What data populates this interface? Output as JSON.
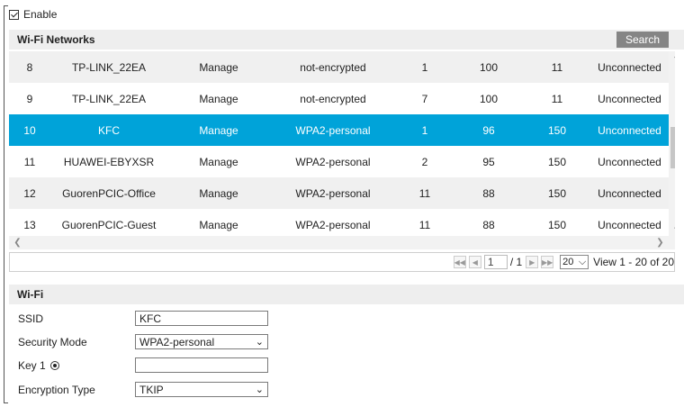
{
  "enable": {
    "label": "Enable",
    "checked": true
  },
  "networks": {
    "title": "Wi-Fi Networks",
    "search_label": "Search",
    "rows": [
      {
        "no": "8",
        "ssid": "TP-LINK_22EA",
        "mode": "Manage",
        "security": "not-encrypted",
        "channel": "1",
        "signal": "100",
        "speed": "11",
        "status": "Unconnected"
      },
      {
        "no": "9",
        "ssid": "TP-LINK_22EA",
        "mode": "Manage",
        "security": "not-encrypted",
        "channel": "7",
        "signal": "100",
        "speed": "11",
        "status": "Unconnected"
      },
      {
        "no": "10",
        "ssid": "KFC",
        "mode": "Manage",
        "security": "WPA2-personal",
        "channel": "1",
        "signal": "96",
        "speed": "150",
        "status": "Unconnected",
        "selected": true
      },
      {
        "no": "11",
        "ssid": "HUAWEI-EBYXSR",
        "mode": "Manage",
        "security": "WPA2-personal",
        "channel": "2",
        "signal": "95",
        "speed": "150",
        "status": "Unconnected"
      },
      {
        "no": "12",
        "ssid": "GuorenPCIC-Office",
        "mode": "Manage",
        "security": "WPA2-personal",
        "channel": "11",
        "signal": "88",
        "speed": "150",
        "status": "Unconnected"
      },
      {
        "no": "13",
        "ssid": "GuorenPCIC-Guest",
        "mode": "Manage",
        "security": "WPA2-personal",
        "channel": "11",
        "signal": "88",
        "speed": "150",
        "status": "Unconnected"
      }
    ],
    "selected_color": "#00a3d9",
    "pager": {
      "page": "1",
      "total": "/ 1",
      "per_page": "20",
      "view_info": "View 1 - 20 of 20"
    }
  },
  "wifi": {
    "title": "Wi-Fi",
    "ssid_label": "SSID",
    "ssid_value": "KFC",
    "security_label": "Security Mode",
    "security_value": "WPA2-personal",
    "key_label": "Key 1",
    "key_value": "",
    "encryption_label": "Encryption Type",
    "encryption_value": "TKIP"
  }
}
